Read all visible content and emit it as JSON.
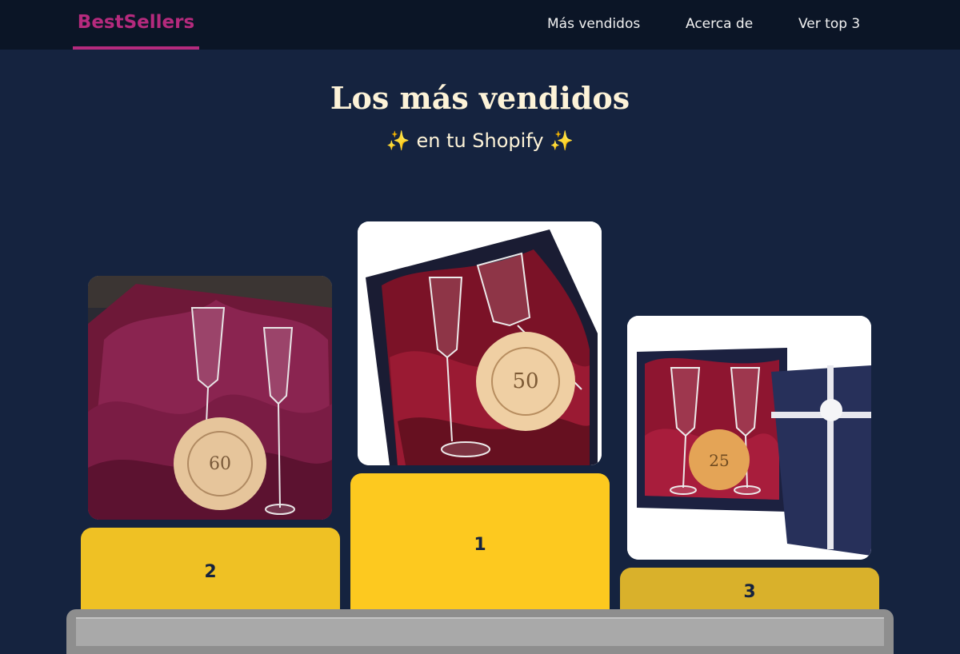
{
  "nav": {
    "brand": "BestSellers",
    "links": [
      "Más vendidos",
      "Acerca de",
      "Ver top 3"
    ]
  },
  "hero": {
    "title": "Los más vendidos",
    "subtitle_prefix": "✨",
    "subtitle_text": "en tu Shopify",
    "subtitle_suffix": "✨"
  },
  "podium": {
    "places": [
      {
        "rank": "2",
        "photo_icon": "wedding-glasses-gift-box-60-years"
      },
      {
        "rank": "1",
        "photo_icon": "wedding-glasses-gift-box-50-years"
      },
      {
        "rank": "3",
        "photo_icon": "wedding-glasses-gift-box-25-years"
      }
    ]
  },
  "colors": {
    "background": "#15233f",
    "topbar": "#0b1526",
    "brand": "#b52a7d",
    "title": "#fdf3d8",
    "podium_first": "#fdc91f",
    "podium_second": "#efc124",
    "podium_third": "#d9b12b",
    "base": "#8e8e8e"
  }
}
